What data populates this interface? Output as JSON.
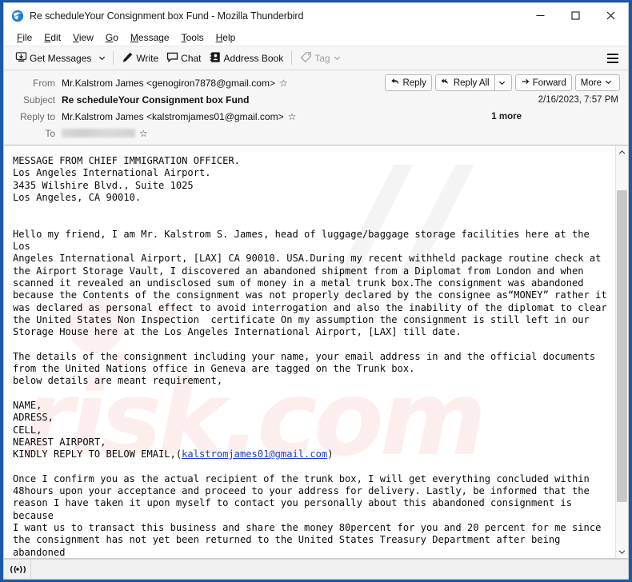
{
  "window": {
    "title": "Re scheduleYour Consignment box Fund - Mozilla Thunderbird",
    "app_icon": "thunderbird-icon",
    "minimize_label": "–",
    "maximize_label": "□",
    "close_label": "✕"
  },
  "menubar": {
    "items": [
      {
        "label": "File",
        "accesskey": "F"
      },
      {
        "label": "Edit",
        "accesskey": "E"
      },
      {
        "label": "View",
        "accesskey": "V"
      },
      {
        "label": "Go",
        "accesskey": "G"
      },
      {
        "label": "Message",
        "accesskey": "M"
      },
      {
        "label": "Tools",
        "accesskey": "T"
      },
      {
        "label": "Help",
        "accesskey": "H"
      }
    ]
  },
  "toolbar": {
    "get_messages": "Get Messages",
    "write": "Write",
    "chat": "Chat",
    "address_book": "Address Book",
    "tag": "Tag",
    "app_menu": "app-menu"
  },
  "message_header": {
    "from_label": "From",
    "from_value": "Mr.Kalstrom James <genogiron7878@gmail.com>",
    "subject_label": "Subject",
    "subject_value": "Re scheduleYour Consignment box Fund",
    "date": "2/16/2023, 7:57 PM",
    "replyto_label": "Reply to",
    "replyto_value": "Mr.Kalstrom James <kalstromjames01@gmail.com>",
    "more_label": "1 more",
    "to_label": "To",
    "to_value": "",
    "star_glyph": "☆",
    "actions": {
      "reply": "Reply",
      "reply_all": "Reply All",
      "forward": "Forward",
      "more": "More"
    }
  },
  "body": {
    "watermark_text": "risk.com",
    "part1": "MESSAGE FROM CHIEF IMMIGRATION OFFICER.\nLos Angeles International Airport.\n3435 Wilshire Blvd., Suite 1025\nLos Angeles, CA 90010.\n\n\nHello my friend, I am Mr. Kalstrom S. James, head of luggage/baggage storage facilities here at the Los\nAngeles International Airport, [LAX] CA 90010. USA.During my recent withheld package routine check at\nthe Airport Storage Vault, I discovered an abandoned shipment from a Diplomat from London and when\nscanned it revealed an undisclosed sum of money in a metal trunk box.The consignment was abandoned\nbecause the Contents of the consignment was not properly declared by the consignee as“MONEY” rather it\nwas declared as personal effect to avoid interrogation and also the inability of the diplomat to clear\nthe United States Non Inspection  certificate On my assumption the consignment is still left in our\nStorage House here at the Los Angeles International Airport, [LAX] till date.\n\nThe details of the consignment including your name, your email address in and the official documents\nfrom the United Nations office in Geneva are tagged on the Trunk box.\nbelow details are meant requirement,\n\nNAME,\nADRESS,\nCELL,\nNEAREST AIRPORT,\nKINDLY REPLY TO BELOW EMAIL,(",
    "link_text": "kalstromjames01@gmail.com",
    "part2": ")\n\nOnce I confirm you as the actual recipient of the trunk box, I will get everything concluded within\n48hours upon your acceptance and proceed to your address for delivery. Lastly, be informed that the\nreason I have taken it upon myself to contact you personally about this abandoned consignment is because\nI want us to transact this business and share the money 80percent for you and 20 percent for me since\nthe consignment has not yet been returned to the United States Treasury Department after being abandoned\nby the diplomat so immediately the confirmation is made, I will go ahead and pay for the United States\nNon Inspection certificate and arrange for the box to be delivered to your doorstep."
  },
  "scrollbar": {
    "up_glyph": "⌃",
    "down_glyph": "⌄"
  },
  "statusbar": {
    "connection_icon": "online-status-icon",
    "text": ""
  },
  "colors": {
    "window_border": "#1b5aa6",
    "toolbar_bg": "#f6f6f6",
    "header_bg": "#f6f6f6",
    "link": "#1a3ec8",
    "scrollbar_thumb": "#c7c7c7"
  }
}
